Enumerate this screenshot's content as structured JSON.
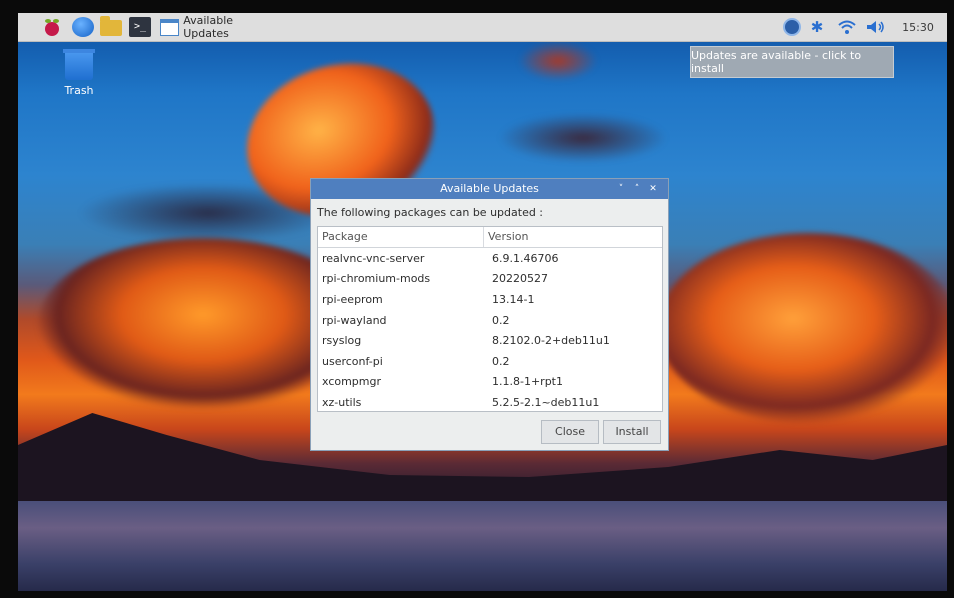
{
  "taskbar": {
    "task_title": "Available Updates",
    "clock": "15:30"
  },
  "notification": {
    "text": "Updates are available - click to install"
  },
  "desktop": {
    "trash_label": "Trash"
  },
  "dialog": {
    "title": "Available Updates",
    "intro": "The following packages can be updated :",
    "columns": {
      "package": "Package",
      "version": "Version"
    },
    "rows": [
      {
        "package": "realvnc-vnc-server",
        "version": "6.9.1.46706"
      },
      {
        "package": "rpi-chromium-mods",
        "version": "20220527"
      },
      {
        "package": "rpi-eeprom",
        "version": "13.14-1"
      },
      {
        "package": "rpi-wayland",
        "version": "0.2"
      },
      {
        "package": "rsyslog",
        "version": "8.2102.0-2+deb11u1"
      },
      {
        "package": "userconf-pi",
        "version": "0.2"
      },
      {
        "package": "xcompmgr",
        "version": "1.1.8-1+rpt1"
      },
      {
        "package": "xz-utils",
        "version": "5.2.5-2.1~deb11u1"
      }
    ],
    "buttons": {
      "close": "Close",
      "install": "Install"
    }
  },
  "colors": {
    "titlebar": "#4f7fbf",
    "accent_blue": "#2a6fd0"
  },
  "icons": [
    "raspberry-pi-menu-icon",
    "web-browser-icon",
    "file-manager-icon",
    "terminal-icon",
    "updater-icon",
    "bluetooth-icon",
    "wifi-icon",
    "volume-icon",
    "trash-icon"
  ]
}
